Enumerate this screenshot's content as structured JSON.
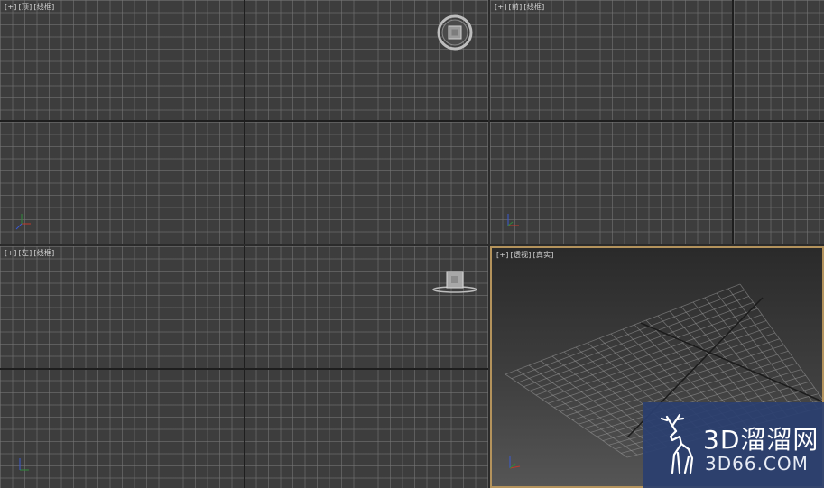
{
  "viewports": {
    "top": {
      "plus": "[+]",
      "view": "[顶]",
      "shading": "[线框]"
    },
    "front": {
      "plus": "[+]",
      "view": "[前]",
      "shading": "[线框]"
    },
    "left": {
      "plus": "[+]",
      "view": "[左]",
      "shading": "[线框]"
    },
    "perspective": {
      "plus": "[+]",
      "view": "[透视]",
      "shading": "[真实]"
    }
  },
  "watermark": {
    "brand": "3D溜溜网",
    "url": "3D66.COM"
  },
  "colors": {
    "viewport_bg": "#3d3d3d",
    "grid_line": "#787878",
    "axis_line": "#1e1e1e",
    "active_border": "#b4935c",
    "watermark_bg": "#2a3f70",
    "axis_x": "#c0392b",
    "axis_y": "#2e8b3a",
    "axis_z": "#3a5bd1"
  }
}
